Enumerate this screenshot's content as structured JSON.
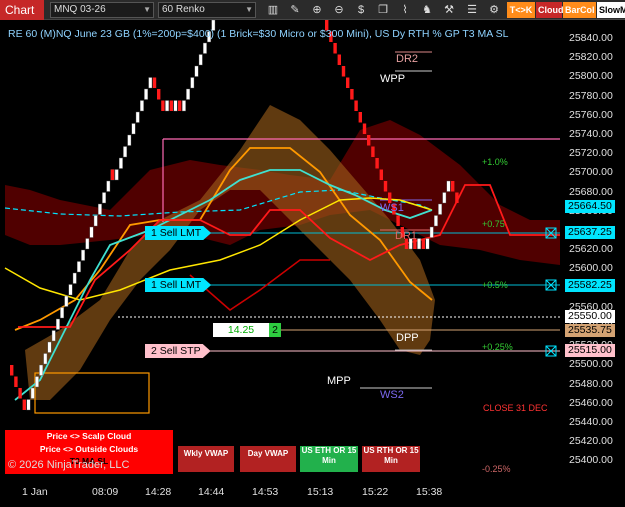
{
  "toolbar": {
    "chart_label": "Chart",
    "instrument": "MNQ 03-26",
    "period": "60 Renko",
    "buttons": [
      {
        "label": "T<>K",
        "color": "#ff8c1a"
      },
      {
        "label": "Cloud",
        "color": "#c62828"
      },
      {
        "label": "BarCol",
        "color": "#ff8c1a"
      },
      {
        "label": "SlowM",
        "color": "#ffffff"
      }
    ],
    "icons": [
      "bar-chart-icon",
      "pencil-icon",
      "zoom-in-icon",
      "zoom-out-icon",
      "dollar-icon",
      "copy-icon",
      "indicators-icon",
      "strategies-icon",
      "tools-icon",
      "properties-icon"
    ]
  },
  "title": "RE 60 (M)NQ June 23 GB (1%=200p=$400) (1 Brick=$30 Micro or $300 Mini), US Dy RTH % GP T3 MA SL",
  "y_axis": {
    "labels": [
      "25840.00",
      "25820.00",
      "25800.00",
      "25780.00",
      "25760.00",
      "25740.00",
      "25720.00",
      "25700.00",
      "25680.00",
      "25660.00",
      "25640.00",
      "25620.00",
      "25600.00",
      "25580.00",
      "25560.00",
      "25540.00",
      "25520.00",
      "25500.00",
      "25480.00",
      "25460.00",
      "25440.00",
      "25420.00",
      "25400.00"
    ]
  },
  "x_axis": {
    "labels": [
      "1 Jan",
      "08:09",
      "14:28",
      "14:44",
      "14:53",
      "15:13",
      "15:22",
      "15:38"
    ]
  },
  "price_tags": [
    {
      "text": "25664.50",
      "bg": "#00e5ff",
      "fg": "#000000"
    },
    {
      "text": "25637.25",
      "bg": "#00e5ff",
      "fg": "#000000"
    },
    {
      "text": "25582.25",
      "bg": "#00e5ff",
      "fg": "#000000"
    },
    {
      "text": "25550.00",
      "bg": "#ffffff",
      "fg": "#000000"
    },
    {
      "text": "25535.75",
      "bg": "#d4a373",
      "fg": "#000000"
    },
    {
      "text": "25515.00",
      "bg": "#ffc0cb",
      "fg": "#000000"
    }
  ],
  "orders": [
    {
      "label": "1 Sell LMT",
      "bg": "#00e5ff"
    },
    {
      "label": "1 Sell LMT",
      "bg": "#00e5ff"
    },
    {
      "label": "2 Sell STP",
      "bg": "#ffc0cb"
    }
  ],
  "position": {
    "price": "14.25",
    "qty": "2"
  },
  "pivots": {
    "dr2": "DR2",
    "wpp": "WPP",
    "ws1": "WS1",
    "dr1": "DR1",
    "dpp": "DPP",
    "mpp": "MPP",
    "ws2": "WS2"
  },
  "percent_labels": {
    "plus_1_0": "+1.0%",
    "plus_0_75": "+0.75",
    "plus_0_5": "+0.5%",
    "plus_0_25": "+0.25%",
    "minus_0_25": "-0.25%"
  },
  "close_label": "CLOSE 31 DEC",
  "legend": {
    "line1": "Price <> Scalp Cloud",
    "line2": "Price <> Outside Clouds",
    "line3": "T3 MA SL"
  },
  "copyright": "© 2026 NinjaTrader, LLC",
  "buttons": {
    "wkly_vwap": "Wkly VWAP",
    "day_vwap": "Day VWAP",
    "us_eth_1": "US ETH OR 15",
    "us_eth_2": "Min",
    "us_rth_1": "US RTH OR 15",
    "us_rth_2": "Min"
  },
  "colors": {
    "bull_brick": "#ffffff",
    "bear_brick": "#ff1a1a",
    "cyan": "#00e5ff",
    "pink": "#ff69b4",
    "orange": "#ff9900",
    "yellow": "#ffe600",
    "cloud_red": "#8b0000",
    "cloud_orange": "#a0611a",
    "green_text": "#33cc33"
  }
}
